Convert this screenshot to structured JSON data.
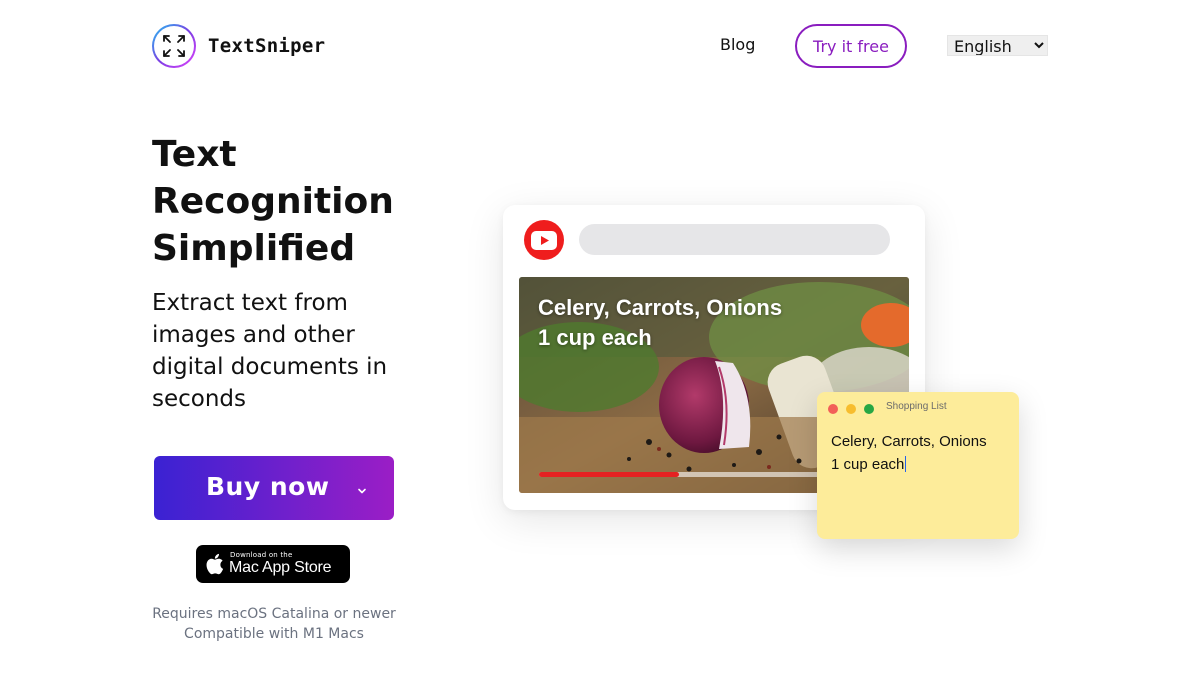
{
  "brand": {
    "name": "TextSniper",
    "logo_icon": "crosshair-corners-icon"
  },
  "nav": {
    "blog": "Blog",
    "try_free": "Try it free",
    "language": "English",
    "language_options": [
      "English"
    ]
  },
  "hero": {
    "title": "Text Recognition Simplified",
    "subtitle": "Extract text from images and other digital documents in seconds"
  },
  "buy": {
    "label": "Buy now",
    "icon": "chevron-down-icon"
  },
  "appstore": {
    "small": "Download on the",
    "big": "Mac App Store",
    "icon": "apple-icon"
  },
  "requirements": {
    "line1": "Requires macOS Catalina or newer",
    "line2": "Compatible with M1 Macs"
  },
  "demo": {
    "video_icon": "youtube-play-icon",
    "caption_line1": "Celery, Carrots, Onions",
    "caption_line2": "1 cup each",
    "progress": 0.4,
    "note": {
      "title": "Shopping List",
      "line1": "Celery, Carrots, Onions",
      "line2": "1 cup each"
    }
  },
  "colors": {
    "accent": "#8a1dbf",
    "buy_gradient_start": "#3a22d3",
    "buy_gradient_end": "#9b1ec6",
    "youtube_red": "#ef1d1d",
    "note_yellow": "#fdec9a",
    "dot_red": "#f25f58",
    "dot_yellow": "#f7bd2e",
    "dot_green": "#27a744"
  }
}
